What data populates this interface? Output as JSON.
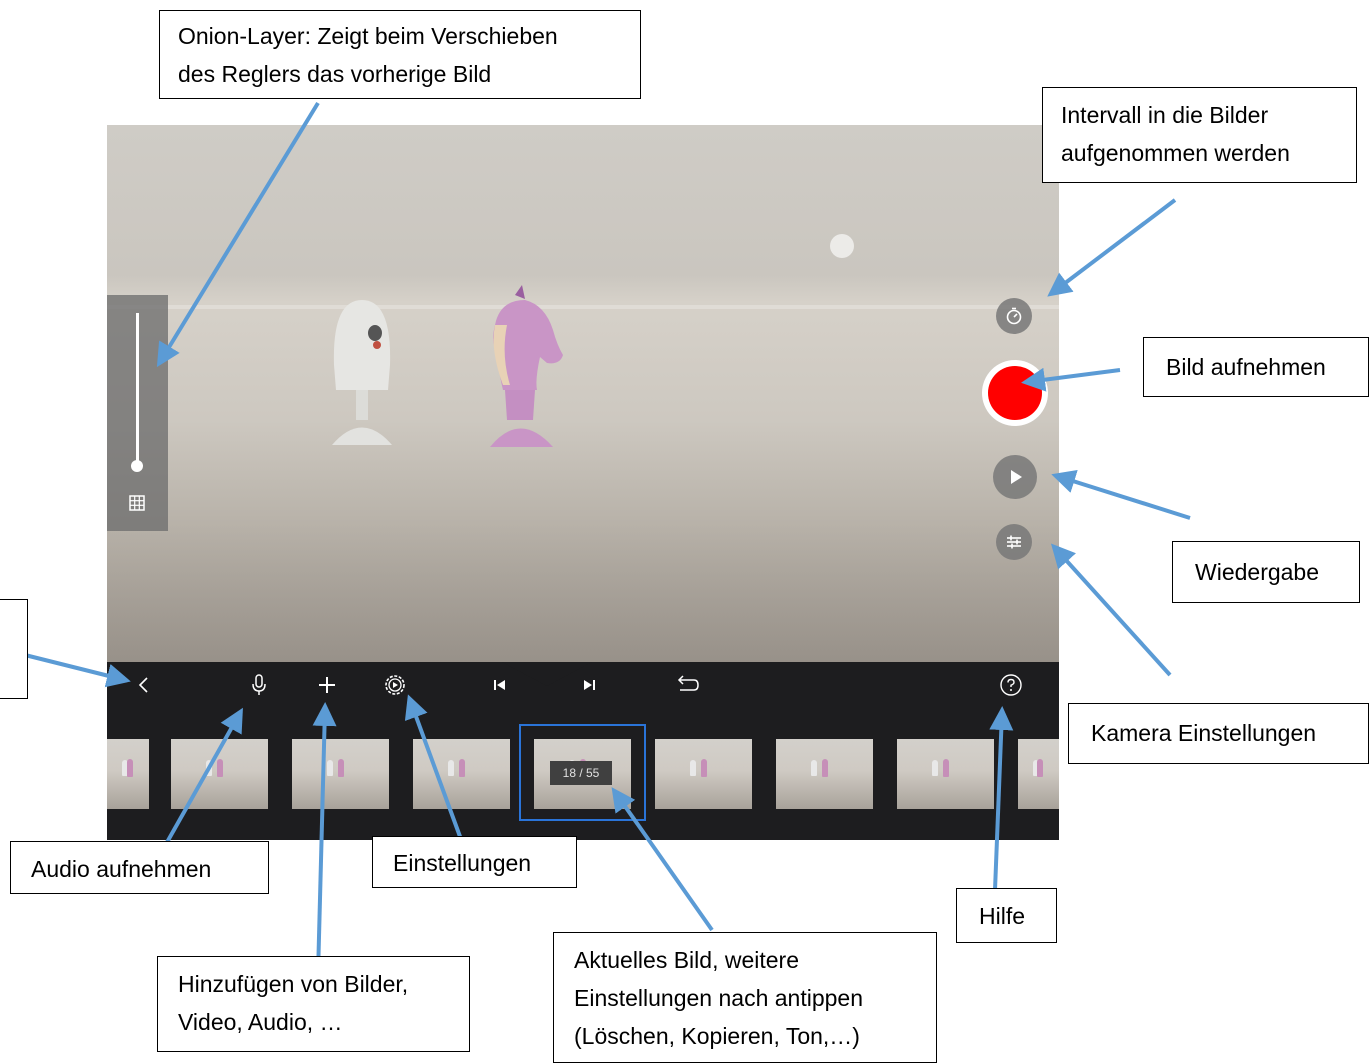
{
  "toolbar": {
    "frame_counter": "18 / 55"
  },
  "callouts": {
    "onion": [
      "Onion-Layer: Zeigt beim Verschieben",
      "des Reglers das vorherige Bild"
    ],
    "intervall": [
      "Intervall in die Bilder",
      "aufgenommen werden"
    ],
    "aufnehmen": "Bild aufnehmen",
    "wiedergabe": "Wiedergabe",
    "kamera": "Kamera Einstellungen",
    "audio": "Audio aufnehmen",
    "einstellungen": "Einstellungen",
    "hilfe": "Hilfe",
    "hinzufuegen": [
      "Hinzufügen von Bilder,",
      "Video, Audio, …"
    ],
    "aktuelles": [
      "Aktuelles Bild, weitere",
      "Einstellungen nach antippen",
      "(Löschen, Kopieren, Ton,…)"
    ]
  },
  "colors": {
    "record": "#ff0000",
    "arrow": "#5b9bd5",
    "selection": "#2a74d8",
    "toolbar_bg": "#1d1d1f"
  },
  "icons": [
    "onion-grid-icon",
    "timer-icon",
    "play-icon",
    "camera-settings-icon",
    "back-chevron-icon",
    "microphone-icon",
    "plus-icon",
    "settings-gear-icon",
    "skip-to-start-icon",
    "skip-to-end-icon",
    "undo-icon",
    "help-icon"
  ]
}
